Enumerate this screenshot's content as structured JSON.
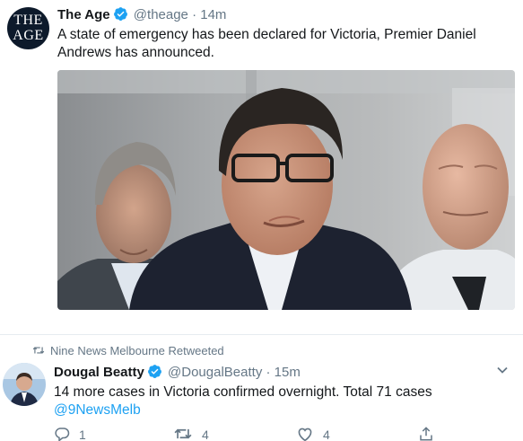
{
  "tweet1": {
    "avatar_text_line1": "THE",
    "avatar_text_line2": "AGE",
    "name": "The Age",
    "handle": "@theage",
    "dot": "·",
    "time": "14m",
    "text": "A state of emergency has been declared for Victoria, Premier Daniel Andrews has announced.",
    "photo_icon": "press-conference-photo"
  },
  "retweet_context": {
    "icon": "retweet-icon",
    "text": "Nine News Melbourne Retweeted"
  },
  "tweet2": {
    "name": "Dougal Beatty",
    "handle": "@DougalBeatty",
    "dot": "·",
    "time": "15m",
    "text": "14 more cases in Victoria confirmed overnight. Total 71 cases",
    "mention": "@9NewsMelb",
    "actions": {
      "reply_count": "1",
      "retweet_count": "4",
      "like_count": "4"
    }
  },
  "colors": {
    "verified": "#1da1f2",
    "link": "#1da1f2",
    "muted": "#657786",
    "text": "#14171a"
  }
}
